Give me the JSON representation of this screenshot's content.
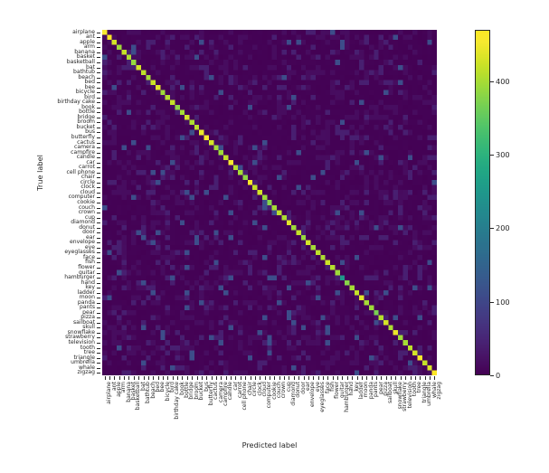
{
  "chart_data": {
    "type": "heatmap",
    "title": "",
    "xlabel": "Predicted label",
    "ylabel": "True label",
    "colormap": "viridis",
    "colorbar": {
      "ticks": [
        0,
        100,
        200,
        300,
        400
      ],
      "tick_labels": [
        "0",
        "100",
        "200",
        "300",
        "400"
      ],
      "vmin": 0,
      "vmax": 470
    },
    "grid": false,
    "categories": [
      "airplane",
      "ant",
      "apple",
      "arm",
      "banana",
      "basket",
      "basketball",
      "bat",
      "bathtub",
      "beach",
      "bed",
      "bee",
      "bicycle",
      "bird",
      "birthday cake",
      "book",
      "bottle",
      "bridge",
      "broom",
      "bucket",
      "bus",
      "butterfly",
      "cactus",
      "camera",
      "campfire",
      "candle",
      "car",
      "carrot",
      "cell phone",
      "chair",
      "circle",
      "clock",
      "cloud",
      "computer",
      "cookie",
      "couch",
      "crown",
      "cup",
      "diamond",
      "donut",
      "door",
      "ear",
      "envelope",
      "eye",
      "eyeglasses",
      "face",
      "fish",
      "flower",
      "guitar",
      "hamburger",
      "hand",
      "key",
      "ladder",
      "moon",
      "panda",
      "pants",
      "pear",
      "pizza",
      "sailboat",
      "skull",
      "snowflake",
      "strawberry",
      "television",
      "tooth",
      "tree",
      "triangle",
      "umbrella",
      "whale",
      "zigzag"
    ],
    "diagonal_values": [
      455,
      470,
      430,
      395,
      420,
      405,
      390,
      430,
      415,
      400,
      425,
      440,
      395,
      410,
      420,
      385,
      400,
      430,
      405,
      415,
      445,
      460,
      430,
      400,
      395,
      420,
      455,
      410,
      400,
      385,
      465,
      420,
      430,
      395,
      380,
      400,
      415,
      405,
      440,
      395,
      420,
      390,
      430,
      400,
      415,
      405,
      425,
      410,
      395,
      250,
      380,
      400,
      420,
      440,
      400,
      395,
      370,
      410,
      430,
      405,
      445,
      395,
      400,
      415,
      430,
      460,
      420,
      435,
      470
    ],
    "offdiagonal_note": "sparse low-count confusions, mostly 0-40, a few cells near 60-110"
  },
  "axes": {
    "xlabel": "Predicted label",
    "ylabel": "True label"
  }
}
